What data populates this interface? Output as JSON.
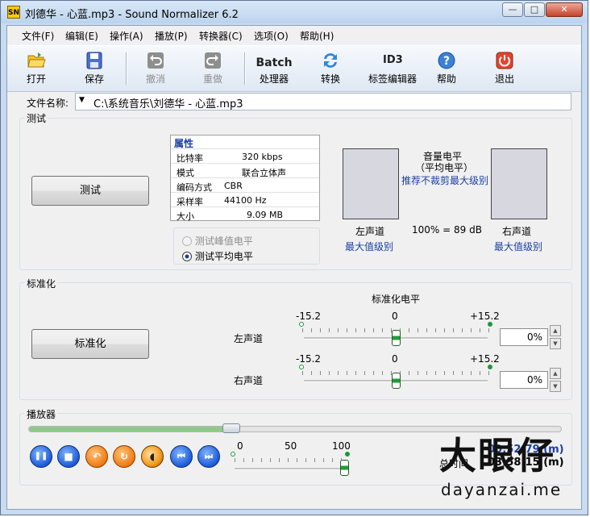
{
  "window": {
    "title": "刘德华 - 心蓝.mp3 - Sound Normalizer 6.2",
    "app_icon_text": "SN",
    "min_label": "—",
    "max_label": "□",
    "close_label": "✕"
  },
  "menu": [
    "文件(F)",
    "编辑(E)",
    "操作(A)",
    "播放(P)",
    "转换器(C)",
    "选项(O)",
    "帮助(H)"
  ],
  "toolbar": {
    "open": "打开",
    "save": "保存",
    "undo": "撤消",
    "redo": "重做",
    "batch_top": "Batch",
    "batch": "处理器",
    "convert": "转换",
    "tag_editor": "标签编辑器",
    "help": "帮助",
    "exit": "退出",
    "tag_icon_text": "ID3"
  },
  "file": {
    "label": "文件名称:",
    "path": "C:\\系统音乐\\刘德华 - 心蓝.mp3",
    "dropdown_arrow": "▼"
  },
  "test": {
    "group_title": "测试",
    "button": "测试",
    "props_header": "属性",
    "props": [
      {
        "key": "比特率",
        "value": "320 kbps"
      },
      {
        "key": "模式",
        "value": "联合立体声"
      },
      {
        "key": "编码方式",
        "value": "CBR"
      },
      {
        "key": "采样率",
        "value": "44100 Hz"
      },
      {
        "key": "大小",
        "value": "9.09 MB"
      }
    ],
    "radio_peak": "测试峰值电平",
    "radio_avg": "测试平均电平",
    "selected_radio": "avg",
    "volume_title": "音量电平",
    "volume_sub": "（平均电平）",
    "recommend": "推荐不裁剪最大级别",
    "left_channel": "左声道",
    "right_channel": "右声道",
    "left_max": "最大值级别",
    "right_max": "最大值级别",
    "ratio": "100% = 89 dB"
  },
  "normalize": {
    "group_title": "标准化",
    "button": "标准化",
    "level_title": "标准化电平",
    "left": {
      "label": "左声道",
      "min": "-15.2",
      "mid": "0",
      "max": "+15.2",
      "value": "0%",
      "position": 0
    },
    "right": {
      "label": "右声道",
      "min": "-15.2",
      "mid": "0",
      "max": "+15.2",
      "value": "0%",
      "position": 0
    },
    "spin_up": "▲",
    "spin_down": "▼"
  },
  "player": {
    "group_title": "播放器",
    "progress": 0.38,
    "vol_min": "0",
    "vol_mid": "50",
    "vol_max": "100",
    "volume": 100,
    "current_time": "00:52:79 (m)",
    "total_label": "总时间",
    "total_time": "03:58:15 (m)",
    "buttons": {
      "pause": "❚❚",
      "stop": "■",
      "prev_orange": "↶",
      "loop": "↻",
      "speaker": "◖",
      "rewind": "⏮",
      "forward": "⏭"
    }
  },
  "watermark": {
    "text_cn": "大眼仔",
    "domain": "dayanzai.me"
  },
  "colors": {
    "accent_blue": "#1b3fa6",
    "slider_green": "#1f9d3a",
    "window_frame": "#c9dbef"
  }
}
